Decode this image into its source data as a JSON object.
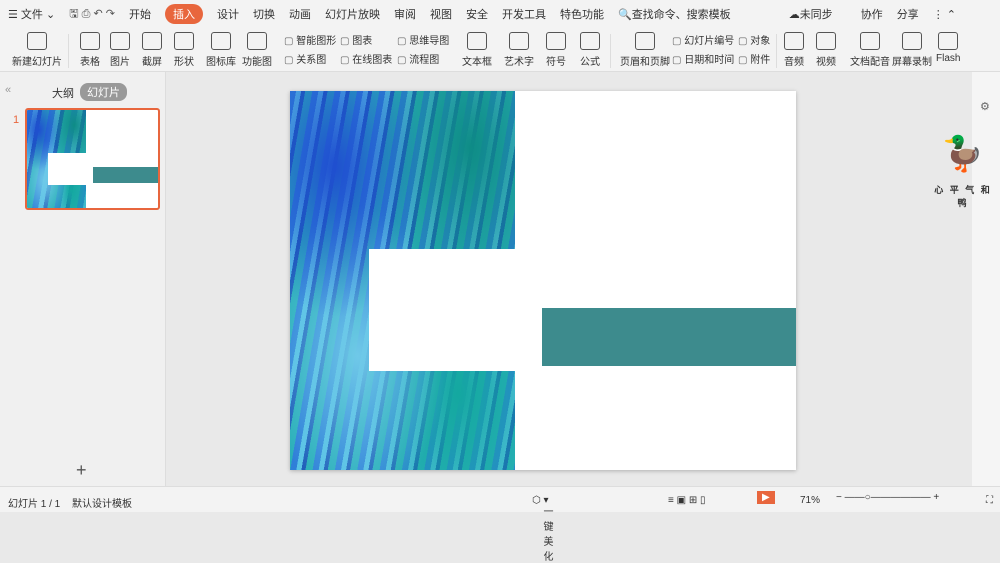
{
  "menubar": {
    "file": "文件",
    "tabs": [
      "开始",
      "插入",
      "设计",
      "切换",
      "动画",
      "幻灯片放映",
      "审阅",
      "视图",
      "安全",
      "开发工具",
      "特色功能"
    ],
    "active_tab": "插入",
    "search": "查找命令、搜索模板",
    "sync": "未同步",
    "collab": "协作",
    "share": "分享"
  },
  "ribbon": {
    "big": [
      "新建幻灯片",
      "表格",
      "图片",
      "截屏",
      "形状",
      "图标库",
      "功能图",
      "文本框",
      "艺术字",
      "符号",
      "公式",
      "页眉和页脚",
      "音频",
      "视频",
      "文档配音",
      "屏幕录制",
      "Flash"
    ],
    "small": [
      "智能图形",
      "关系图",
      "图表",
      "在线图表",
      "思维导图",
      "流程图",
      "幻灯片编号",
      "日期和时间",
      "对象",
      "附件"
    ]
  },
  "panel": {
    "tab_outline": "大纲",
    "tab_slides": "幻灯片",
    "slide_number": "1",
    "add": "+"
  },
  "status": {
    "slide_info": "幻灯片 1 / 1",
    "template": "默认设计模板",
    "beautify": "一键美化",
    "zoom": "71%"
  },
  "slide": {
    "bar_color": "#3d8b8d"
  },
  "watermark": "心平气和鸭"
}
